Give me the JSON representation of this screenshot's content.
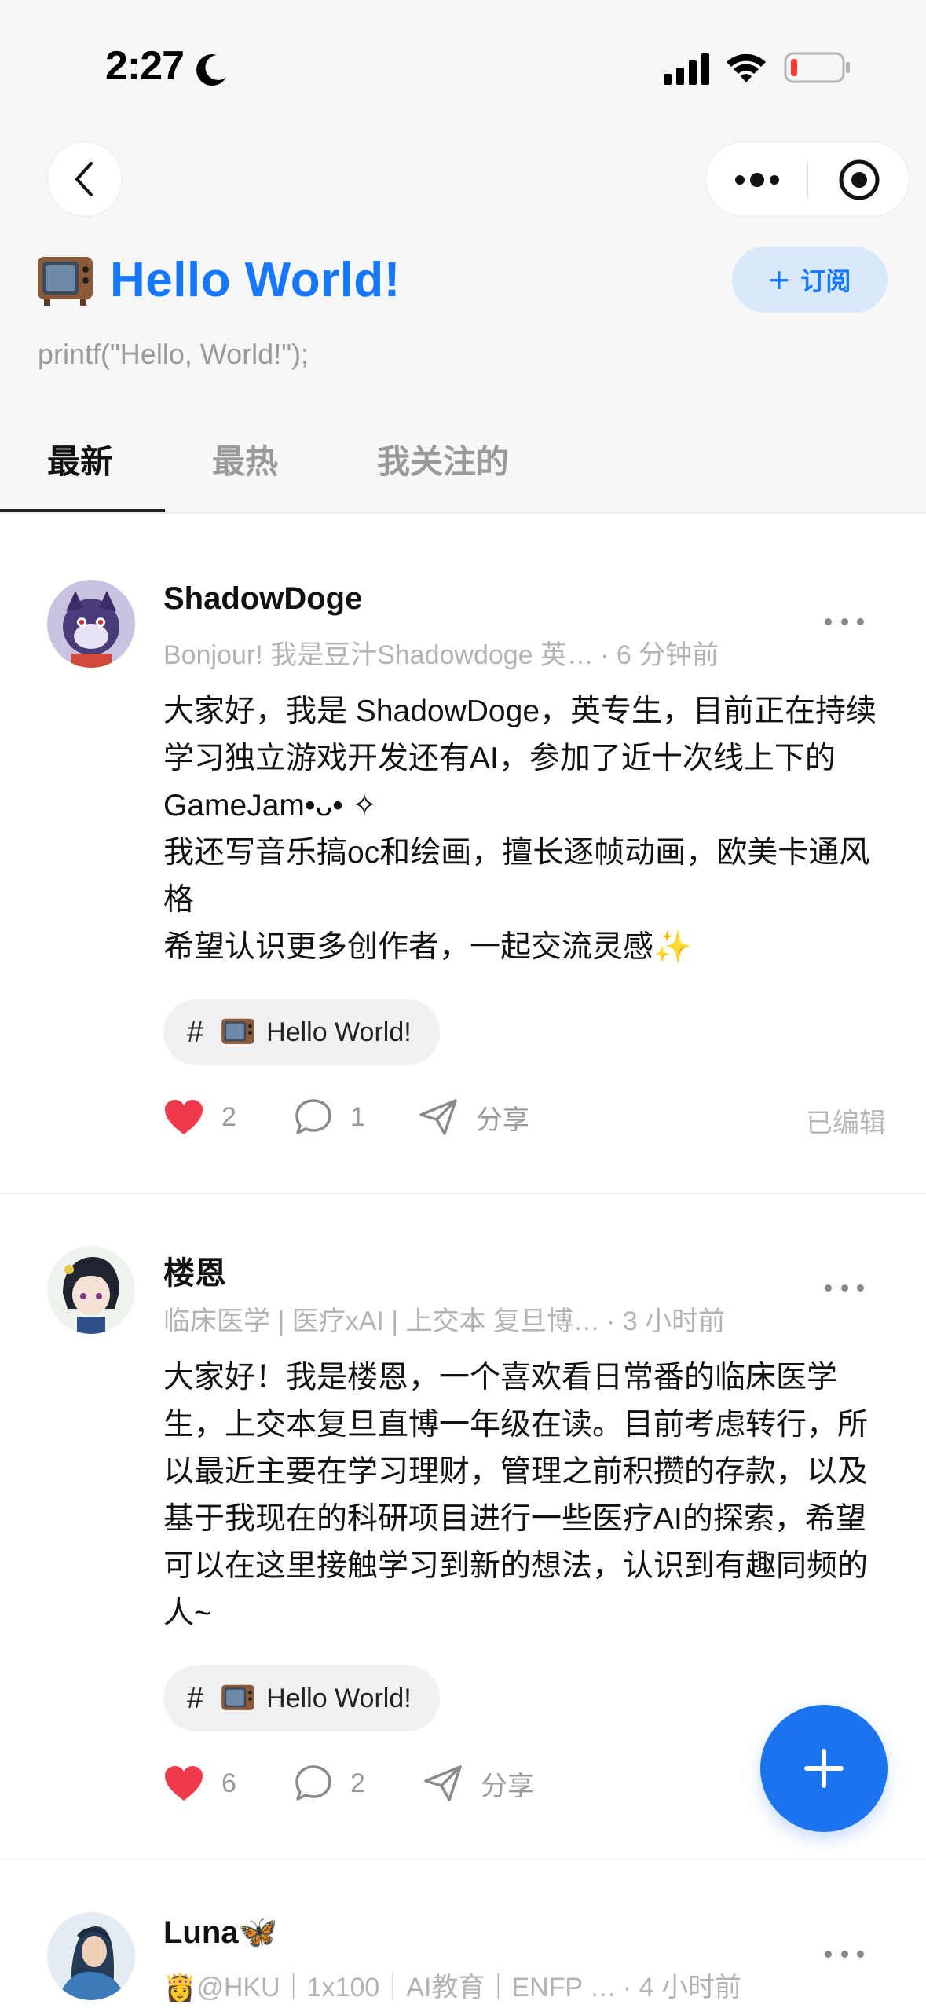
{
  "status_bar": {
    "time": "2:27"
  },
  "channel": {
    "title": "Hello World!",
    "description": "printf(\"Hello, World!\");",
    "subscribe_label": "订阅"
  },
  "tabs": [
    {
      "label": "最新",
      "active": true
    },
    {
      "label": "最热",
      "active": false
    },
    {
      "label": "我关注的",
      "active": false
    }
  ],
  "posts": [
    {
      "author": "ShadowDoge",
      "bio": "Bonjour! 我是豆汁Shadowdoge 英…",
      "time": "· 6 分钟前",
      "body": "大家好，我是 ShadowDoge，英专生，目前正在持续学习独立游戏开发还有AI，参加了近十次线上下的GameJam•ᴗ• ✧\n我还写音乐搞oc和绘画，擅长逐帧动画，欧美卡通风格\n希望认识更多创作者，一起交流灵感✨",
      "topic": "Hello World!",
      "likes": "2",
      "comments": "1",
      "share_label": "分享",
      "edited_label": "已编辑"
    },
    {
      "author": "楼恩",
      "bio": "临床医学 | 医疗xAI | 上交本 复旦博…",
      "time": "· 3 小时前",
      "body": "大家好！我是楼恩，一个喜欢看日常番的临床医学生，上交本复旦直博一年级在读。目前考虑转行，所以最近主要在学习理财，管理之前积攒的存款，以及基于我现在的科研项目进行一些医疗AI的探索，希望可以在这里接触学习到新的想法，认识到有趣同频的人~",
      "topic": "Hello World!",
      "likes": "6",
      "comments": "2",
      "share_label": "分享"
    },
    {
      "author": "Luna🦋",
      "bio": "👸@HKU｜1x100｜AI教育｜ENFP …",
      "time": "· 4 小时前"
    }
  ],
  "colors": {
    "accent": "#1677ff",
    "like_red": "#ee3a4a",
    "fab": "#1b73ee",
    "subscribe_bg": "#d7e9fb"
  },
  "icons": [
    "back-icon",
    "more-dots-icon",
    "mini-program-close-icon",
    "tv-icon",
    "plus-icon",
    "heart-icon",
    "comment-icon",
    "share-icon"
  ]
}
